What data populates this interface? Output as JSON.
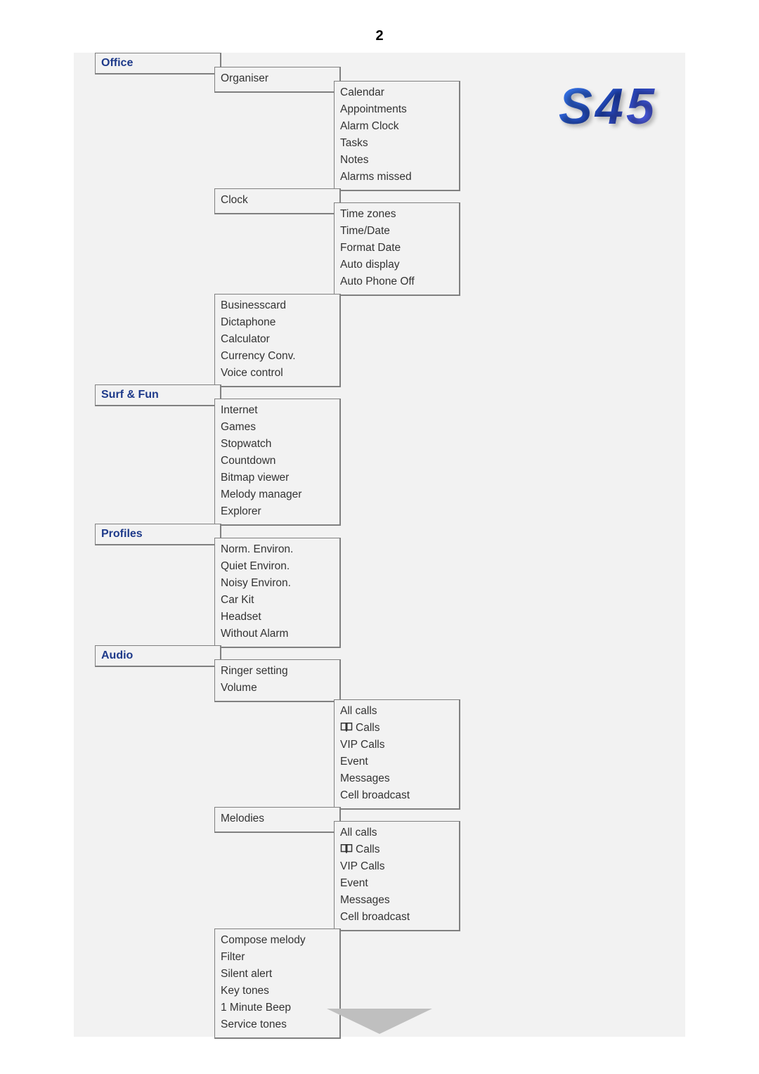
{
  "page_number": "2",
  "logo": "S45",
  "sections": {
    "office": {
      "heading": "Office",
      "sub1_organiser": "Organiser",
      "organiser_items": [
        "Calendar",
        "Appointments",
        "Alarm Clock",
        "Tasks",
        "Notes",
        "Alarms missed"
      ],
      "sub2_clock": "Clock",
      "clock_items": [
        "Time zones",
        "Time/Date",
        "Format Date",
        "Auto display",
        "Auto Phone Off"
      ],
      "rest": [
        "Businesscard",
        "Dictaphone",
        "Calculator",
        "Currency Conv.",
        "Voice control"
      ]
    },
    "surffun": {
      "heading": "Surf & Fun",
      "items": [
        "Internet",
        "Games",
        "Stopwatch",
        "Countdown",
        "Bitmap viewer",
        "Melody manager",
        "Explorer"
      ]
    },
    "profiles": {
      "heading": "Profiles",
      "items": [
        "Norm. Environ.",
        "Quiet Environ.",
        "Noisy Environ.",
        "Car Kit",
        "Headset",
        "Without Alarm"
      ]
    },
    "audio": {
      "heading": "Audio",
      "sub1_top": [
        "Ringer setting",
        "Volume"
      ],
      "volume_items": [
        "All calls",
        "Calls",
        "VIP Calls",
        "Event",
        "Messages",
        "Cell broadcast"
      ],
      "sub2_melodies": "Melodies",
      "melodies_items": [
        "All calls",
        "Calls",
        "VIP Calls",
        "Event",
        "Messages",
        "Cell broadcast"
      ],
      "rest": [
        "Compose melody",
        "Filter",
        "Silent alert",
        "Key tones",
        "1 Minute Beep",
        "Service tones"
      ]
    }
  }
}
